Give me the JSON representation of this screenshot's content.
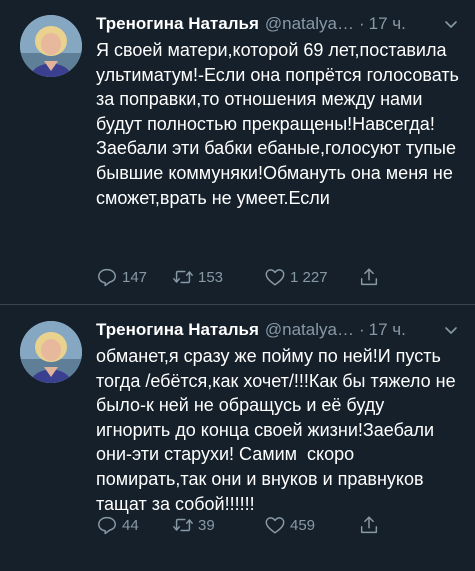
{
  "tweets": [
    {
      "author_name": "Треногина Наталья",
      "handle": "@natalya…",
      "dot": "·",
      "time": "17 ч.",
      "text": "Я своей матери,которой 69 лет,поставила ультиматум!-Если она попрётся голосовать за поправки,то отношения между нами будут полностью прекращены!Навсегда! Заебали эти бабки ебаные,голосуют тупые бывшие коммуняки!Обмануть она меня не сможет,врать не умеет.Если",
      "replies": "147",
      "retweets": "153",
      "likes": "1 227"
    },
    {
      "author_name": "Треногина Наталья",
      "handle": "@natalya…",
      "dot": "·",
      "time": "17 ч.",
      "text": "обманет,я сразу же пойму по ней!И пусть тогда /ебётся,как хочет/!!!Как бы тяжело не было-к ней не обращусь и её буду игнорить до конца своей жизни!Заебали они-эти старухи! Самим  скоро помирать,так они и внуков и правнуков тащат за собой!!!!!!",
      "replies": "44",
      "retweets": "39",
      "likes": "459"
    }
  ],
  "icons": {
    "reply": "reply-icon",
    "retweet": "retweet-icon",
    "like": "heart-icon",
    "share": "share-icon",
    "more": "chevron-down-icon"
  },
  "colors": {
    "background": "#15202b",
    "secondary_text": "#8899a6",
    "divider": "#38444d"
  }
}
